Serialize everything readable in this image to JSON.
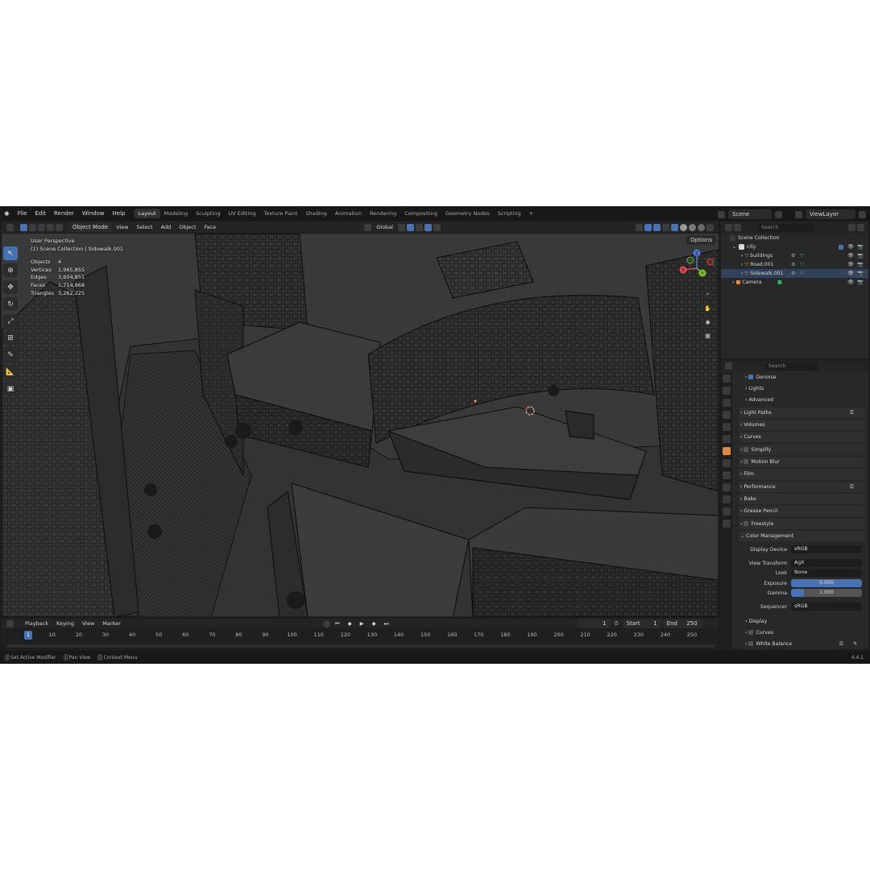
{
  "menu": {
    "items": [
      "File",
      "Edit",
      "Render",
      "Window",
      "Help"
    ],
    "workspaces": [
      "Layout",
      "Modeling",
      "Sculpting",
      "UV Editing",
      "Texture Paint",
      "Shading",
      "Animation",
      "Rendering",
      "Compositing",
      "Geometry Nodes",
      "Scripting"
    ],
    "add_tab": "+",
    "scene": "Scene",
    "view_layer": "ViewLayer"
  },
  "header": {
    "mode": "Object Mode",
    "view": "View",
    "select": "Select",
    "add": "Add",
    "object": "Object",
    "face": "Face",
    "orientation": "Global",
    "options": "Options"
  },
  "viewport": {
    "perspective": "User Perspective",
    "collection": "(1) Scene Collection | Sidewalk.001",
    "stats": [
      {
        "label": "Objects",
        "value": "4"
      },
      {
        "label": "Vertices",
        "value": "1,965,855"
      },
      {
        "label": "Edges",
        "value": "3,604,851"
      },
      {
        "label": "Faces",
        "value": "1,714,868"
      },
      {
        "label": "Triangles",
        "value": "3,262,225"
      }
    ],
    "gizmo": {
      "x": "X",
      "y": "Y",
      "z": "Z"
    }
  },
  "outliner": {
    "search_placeholder": "Search",
    "root": "Scene Collection",
    "collection": "city",
    "items": [
      "buildings",
      "Road.001",
      "Sidewalk.001"
    ],
    "camera": "Camera"
  },
  "properties": {
    "search_placeholder": "Search",
    "denoise": "Denoise",
    "lights": "Lights",
    "advanced": "Advanced",
    "sections": [
      "Light Paths",
      "Volumes",
      "Curves",
      "Simplify",
      "Motion Blur",
      "Film",
      "Performance",
      "Bake",
      "Grease Pencil",
      "Freestyle",
      "Color Management"
    ],
    "color_management": {
      "display_device_label": "Display Device",
      "display_device": "sRGB",
      "view_transform_label": "View Transform",
      "view_transform": "AgX",
      "look_label": "Look",
      "look": "None",
      "exposure_label": "Exposure",
      "exposure": "0.000",
      "gamma_label": "Gamma",
      "gamma": "1.000",
      "sequencer_label": "Sequencer",
      "sequencer": "sRGB"
    },
    "subsections": [
      "Display",
      "Curves",
      "White Balance"
    ]
  },
  "timeline": {
    "playback": "Playback",
    "keying": "Keying",
    "view": "View",
    "marker": "Marker",
    "current_frame": "1",
    "start_label": "Start",
    "start": "1",
    "end_label": "End",
    "end": "250",
    "ticks": [
      "1",
      "10",
      "20",
      "30",
      "40",
      "50",
      "60",
      "70",
      "80",
      "90",
      "100",
      "110",
      "120",
      "130",
      "140",
      "150",
      "160",
      "170",
      "180",
      "190",
      "200",
      "210",
      "220",
      "230",
      "240",
      "250"
    ]
  },
  "status": {
    "left1": "Set Active Modifier",
    "left2": "Pan View",
    "left3": "Context Menu",
    "version": "4.4.1"
  },
  "colors": {
    "accent": "#4772b3",
    "panel": "#282828",
    "viewport_bg": "#3a3a3a",
    "mesh_icon": "#2fb56b",
    "collection_icon": "#e8923a"
  }
}
